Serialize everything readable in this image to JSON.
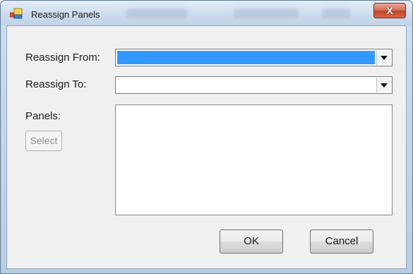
{
  "window": {
    "title": "Reassign Panels",
    "close_glyph": "X"
  },
  "form": {
    "from_label": "Reassign From:",
    "from_value": "",
    "to_label": "Reassign To:",
    "to_value": "",
    "panels_label": "Panels:",
    "select_label": "Select"
  },
  "footer": {
    "ok_label": "OK",
    "cancel_label": "Cancel"
  },
  "colors": {
    "selection": "#3399ff"
  },
  "icons": {
    "app": "app-icon",
    "close": "close-icon",
    "dropdown": "chevron-down-icon"
  }
}
